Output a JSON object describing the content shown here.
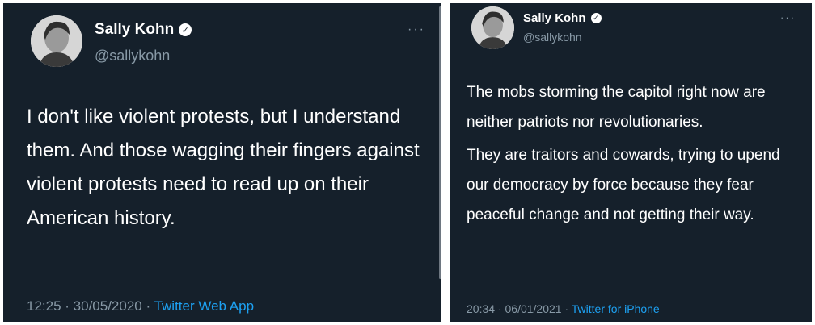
{
  "left_tweet": {
    "name": "Sally Kohn",
    "handle": "@sallykohn",
    "more": "···",
    "text": "I don't like violent protests, but I understand them.  And those wagging their fingers against violent protests need to read up on their American history.",
    "time": "12:25",
    "date": "30/05/2020",
    "source": "Twitter Web App"
  },
  "right_tweet": {
    "name": "Sally Kohn",
    "handle": "@sallykohn",
    "more": "···",
    "paragraph_1": "The mobs storming the capitol right now are neither patriots nor revolutionaries.",
    "paragraph_2": "They are traitors and cowards, trying to upend our democracy by force because they fear peaceful change and not getting their way.",
    "time": "20:34",
    "date": "06/01/2021",
    "source": "Twitter for iPhone"
  },
  "separator": " · ",
  "colors": {
    "background": "#15202b",
    "text": "#ffffff",
    "muted": "#8899a6",
    "link": "#1da1f2"
  },
  "icons": {
    "verified": "verified-badge-icon",
    "more": "more-options-icon"
  }
}
